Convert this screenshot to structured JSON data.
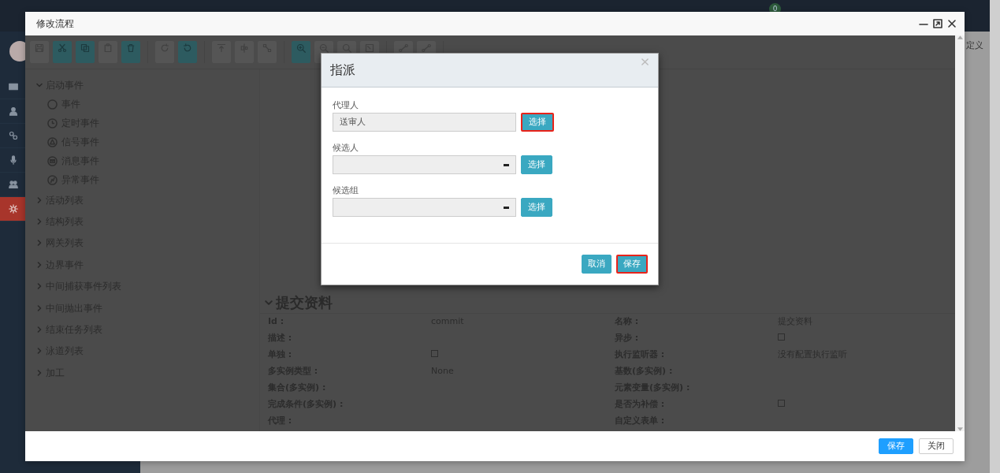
{
  "page": {
    "notification_count": "0",
    "tab_fragment": "定义",
    "sidebar": [
      {
        "selected": false
      },
      {
        "selected": false
      },
      {
        "selected": false
      },
      {
        "selected": false
      },
      {
        "selected": false
      },
      {
        "selected": true
      }
    ]
  },
  "window": {
    "title": "修改流程",
    "toolbar": [
      [
        {
          "enabled": false
        },
        {
          "enabled": true
        },
        {
          "enabled": true
        },
        {
          "enabled": false
        },
        {
          "enabled": true
        }
      ],
      [
        {
          "enabled": false
        },
        {
          "enabled": true
        }
      ],
      [
        {
          "enabled": false
        },
        {
          "enabled": false
        },
        {
          "enabled": false
        }
      ],
      [
        {
          "enabled": true
        },
        {
          "enabled": false
        },
        {
          "enabled": false
        },
        {
          "enabled": false
        }
      ],
      [
        {
          "enabled": false
        },
        {
          "enabled": false
        }
      ]
    ],
    "tree": [
      {
        "label": "启动事件",
        "expanded": true,
        "children": [
          {
            "label": "事件"
          },
          {
            "label": "定时事件"
          },
          {
            "label": "信号事件"
          },
          {
            "label": "消息事件"
          },
          {
            "label": "异常事件"
          }
        ]
      },
      {
        "label": "活动列表",
        "expanded": false
      },
      {
        "label": "结构列表",
        "expanded": false
      },
      {
        "label": "网关列表",
        "expanded": false
      },
      {
        "label": "边界事件",
        "expanded": false
      },
      {
        "label": "中间捕获事件列表",
        "expanded": false
      },
      {
        "label": "中间抛出事件",
        "expanded": false
      },
      {
        "label": "结束任务列表",
        "expanded": false
      },
      {
        "label": "泳道列表",
        "expanded": false
      },
      {
        "label": "加工",
        "expanded": false
      }
    ],
    "properties": {
      "title": "提交资料",
      "expanded": true,
      "rows": [
        [
          {
            "label": "Id :",
            "kind": "text",
            "value": "commit"
          },
          {
            "label": "名称 :",
            "kind": "text",
            "value": "提交资料"
          }
        ],
        [
          {
            "label": "描述 :",
            "kind": "text"
          },
          {
            "label": "异步 :",
            "kind": "checkbox",
            "checked": false
          }
        ],
        [
          {
            "label": "单独 :",
            "kind": "checkbox",
            "checked": false
          },
          {
            "label": "执行监听器 :",
            "kind": "text",
            "value": "没有配置执行监听"
          }
        ],
        [
          {
            "label": "多实例类型 :",
            "kind": "text",
            "value": "None"
          },
          {
            "label": "基数(多实例) :",
            "kind": "text"
          }
        ],
        [
          {
            "label": "集合(多实例) :",
            "kind": "text"
          },
          {
            "label": "元素变量(多实例) :",
            "kind": "text"
          }
        ],
        [
          {
            "label": "完成条件(多实例) :",
            "kind": "text"
          },
          {
            "label": "是否为补偿 :",
            "kind": "checkbox",
            "checked": false
          }
        ],
        [
          {
            "label": "代理 :",
            "kind": "text"
          },
          {
            "label": "自定义表单 :",
            "kind": "text"
          }
        ]
      ]
    },
    "buttons": [
      {
        "label": "保存",
        "kind": "primary"
      },
      {
        "label": "关闭",
        "kind": "default"
      }
    ]
  },
  "dialog": {
    "title": "指派",
    "fields": [
      {
        "label": "代理人",
        "value": "送审人",
        "clearable": false,
        "button": {
          "label": "选择",
          "highlighted": true
        }
      },
      {
        "label": "候选人",
        "clearable": true,
        "button": {
          "label": "选择",
          "highlighted": false
        }
      },
      {
        "label": "候选组",
        "clearable": true,
        "button": {
          "label": "选择",
          "highlighted": false
        }
      }
    ],
    "buttons": [
      {
        "label": "取消",
        "highlighted": false
      },
      {
        "label": "保存",
        "highlighted": true
      }
    ]
  }
}
